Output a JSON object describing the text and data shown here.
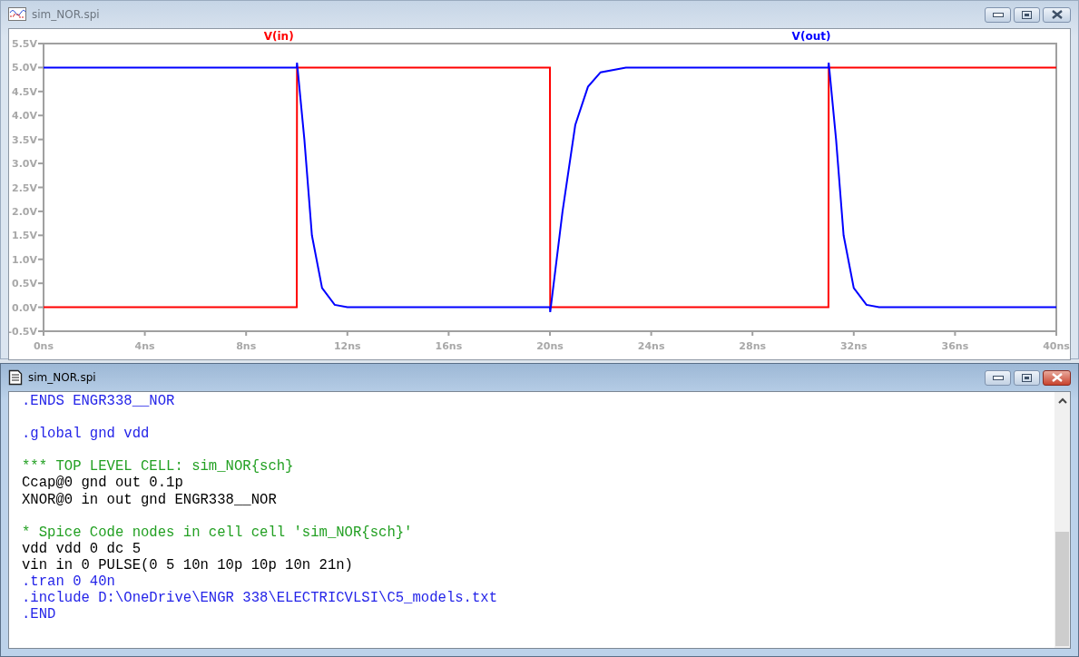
{
  "plot_window": {
    "title": "sim_NOR.spi",
    "active": false,
    "chart_data": {
      "type": "line",
      "x": [
        0,
        10,
        10.01,
        10.3,
        10.6,
        11,
        11.5,
        12,
        20,
        20.01,
        20.5,
        21,
        21.5,
        22,
        23,
        31,
        31.01,
        31.3,
        31.6,
        32,
        32.5,
        33,
        40
      ],
      "series": [
        {
          "name": "V(in)",
          "color": "#ff0000",
          "values": [
            0,
            0,
            5,
            5,
            5,
            5,
            5,
            5,
            5,
            0,
            0,
            0,
            0,
            0,
            0,
            0,
            5,
            5,
            5,
            5,
            5,
            5,
            5
          ]
        },
        {
          "name": "V(out)",
          "color": "#0000ff",
          "values": [
            5,
            5,
            5.1,
            3.5,
            1.5,
            0.4,
            0.05,
            0,
            0,
            -0.1,
            2,
            3.8,
            4.6,
            4.9,
            5,
            5,
            5.1,
            3.5,
            1.5,
            0.4,
            0.05,
            0,
            0
          ]
        }
      ],
      "xlim": [
        0,
        40
      ],
      "ylim": [
        -0.5,
        5.5
      ],
      "xticks": [
        {
          "value": 0,
          "label": "0ns"
        },
        {
          "value": 4,
          "label": "4ns"
        },
        {
          "value": 8,
          "label": "8ns"
        },
        {
          "value": 12,
          "label": "12ns"
        },
        {
          "value": 16,
          "label": "16ns"
        },
        {
          "value": 20,
          "label": "20ns"
        },
        {
          "value": 24,
          "label": "24ns"
        },
        {
          "value": 28,
          "label": "28ns"
        },
        {
          "value": 32,
          "label": "32ns"
        },
        {
          "value": 36,
          "label": "36ns"
        },
        {
          "value": 40,
          "label": "40ns"
        }
      ],
      "yticks": [
        {
          "value": 5.5,
          "label": "5.5V"
        },
        {
          "value": 5,
          "label": "5.0V"
        },
        {
          "value": 4.5,
          "label": "4.5V"
        },
        {
          "value": 4,
          "label": "4.0V"
        },
        {
          "value": 3.5,
          "label": "3.5V"
        },
        {
          "value": 3,
          "label": "3.0V"
        },
        {
          "value": 2.5,
          "label": "2.5V"
        },
        {
          "value": 2,
          "label": "2.0V"
        },
        {
          "value": 1.5,
          "label": "1.5V"
        },
        {
          "value": 1,
          "label": "1.0V"
        },
        {
          "value": 0.5,
          "label": "0.5V"
        },
        {
          "value": 0,
          "label": "0.0V"
        },
        {
          "value": -0.5,
          "label": "-0.5V"
        }
      ]
    }
  },
  "netlist_window": {
    "title": "sim_NOR.spi",
    "active": true,
    "lines": [
      {
        "kind": "directive",
        "text": ".ENDS ENGR338__NOR"
      },
      {
        "kind": "blank"
      },
      {
        "kind": "directive",
        "text": ".global gnd vdd"
      },
      {
        "kind": "blank"
      },
      {
        "kind": "comment",
        "text": "*** TOP LEVEL CELL: sim_NOR{sch}"
      },
      {
        "kind": "element",
        "text": "Ccap@0 gnd out 0.1p"
      },
      {
        "kind": "element",
        "text": "XNOR@0 in out gnd ENGR338__NOR"
      },
      {
        "kind": "blank"
      },
      {
        "kind": "comment",
        "text": "* Spice Code nodes in cell cell 'sim_NOR{sch}'"
      },
      {
        "kind": "element",
        "text": "vdd vdd 0 dc 5"
      },
      {
        "kind": "element",
        "text": "vin in 0 PULSE(0 5 10n 10p 10p 10n 21n)"
      },
      {
        "kind": "directive",
        "text": ".tran 0 40n"
      },
      {
        "kind": "directive",
        "text": ".include D:\\OneDrive\\ENGR 338\\ELECTRICVLSI\\C5_models.txt"
      },
      {
        "kind": "directive",
        "text": ".END"
      }
    ]
  }
}
